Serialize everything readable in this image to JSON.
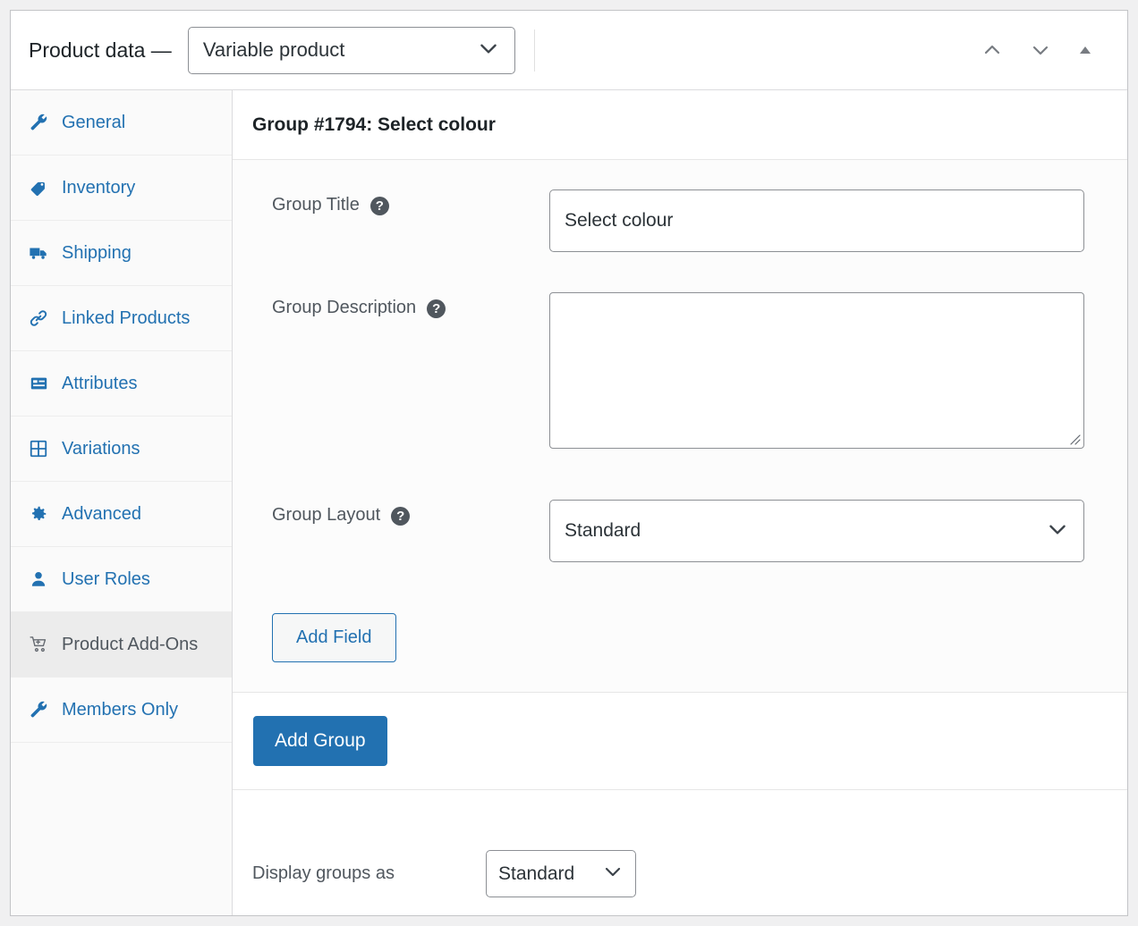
{
  "header": {
    "title": "Product data —",
    "product_type": {
      "value": "Variable product",
      "icon": "chevron-down-icon"
    },
    "actions": [
      {
        "name": "move-up-button",
        "icon": "chevron-up-icon"
      },
      {
        "name": "move-down-button",
        "icon": "chevron-down-icon"
      },
      {
        "name": "toggle-panel-button",
        "icon": "triangle-up-icon"
      }
    ]
  },
  "sidebar": {
    "items": [
      {
        "label": "General",
        "icon": "wrench-icon",
        "active": false
      },
      {
        "label": "Inventory",
        "icon": "tag-icon",
        "active": false
      },
      {
        "label": "Shipping",
        "icon": "truck-icon",
        "active": false
      },
      {
        "label": "Linked Products",
        "icon": "link-icon",
        "active": false
      },
      {
        "label": "Attributes",
        "icon": "list-icon",
        "active": false
      },
      {
        "label": "Variations",
        "icon": "grid-icon",
        "active": false
      },
      {
        "label": "Advanced",
        "icon": "gear-icon",
        "active": false
      },
      {
        "label": "User Roles",
        "icon": "user-icon",
        "active": false
      },
      {
        "label": "Product Add-Ons",
        "icon": "cart-icon",
        "active": true
      },
      {
        "label": "Members Only",
        "icon": "wrench-icon",
        "active": false
      }
    ]
  },
  "main": {
    "group_heading": "Group #1794: Select colour",
    "fields": {
      "group_title": {
        "label": "Group Title",
        "help_icon": "help-icon",
        "value": "Select colour",
        "placeholder": ""
      },
      "group_description": {
        "label": "Group Description",
        "help_icon": "help-icon",
        "value": "",
        "placeholder": ""
      },
      "group_layout": {
        "label": "Group Layout",
        "help_icon": "help-icon",
        "value": "Standard",
        "icon": "chevron-down-icon"
      }
    },
    "add_field_label": "Add Field",
    "add_group_label": "Add Group",
    "display_groups": {
      "label": "Display groups as",
      "value": "Standard",
      "icon": "chevron-down-icon"
    }
  },
  "colors": {
    "accent": "#2271b1",
    "text": "#2c3338",
    "muted": "#50575e",
    "border": "#8c8f94",
    "page_bg": "#f0f0f1",
    "active_item_bg": "#ececec"
  }
}
